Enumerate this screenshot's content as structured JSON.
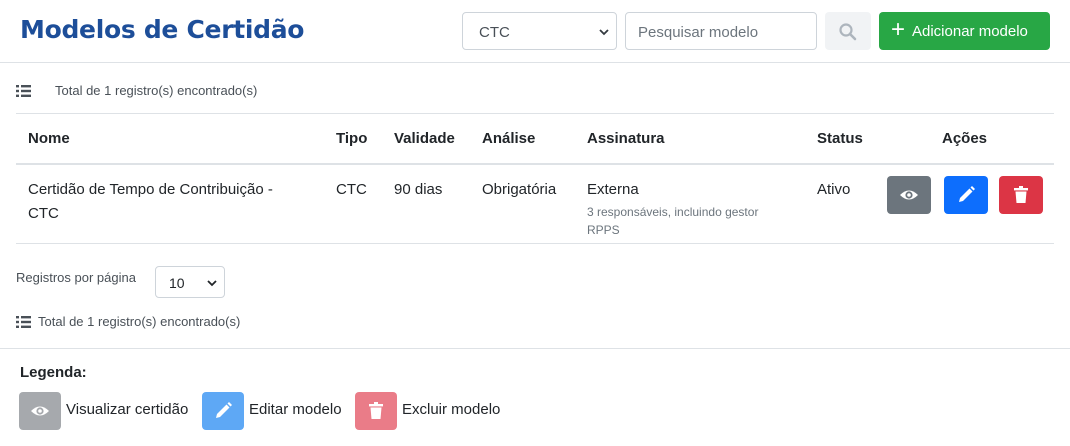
{
  "header": {
    "title": "Modelos de Certidão",
    "type_filter": {
      "selected": "CTC"
    },
    "search": {
      "placeholder": "Pesquisar modelo"
    },
    "add_button": {
      "label": "Adicionar modelo"
    }
  },
  "summary_top": "Total de 1 registro(s) encontrado(s)",
  "table": {
    "columns": [
      "Nome",
      "Tipo",
      "Validade",
      "Análise",
      "Assinatura",
      "Status",
      "Ações"
    ],
    "rows": [
      {
        "nome": "Certidão de Tempo de Contribuição - CTC",
        "tipo": "CTC",
        "validade": "90 dias",
        "analise": "Obrigatória",
        "assinatura": "Externa",
        "assinatura_detail": "3 responsáveis, incluindo gestor RPPS",
        "status": "Ativo"
      }
    ]
  },
  "pagination": {
    "per_page_label": "Registros por página",
    "per_page_value": "10"
  },
  "summary_bottom": "Total de 1 registro(s) encontrado(s)",
  "legend": {
    "title": "Legenda:",
    "items": [
      {
        "label": "Visualizar certidão",
        "icon": "eye-icon",
        "color": "#a6a9ad"
      },
      {
        "label": "Editar modelo",
        "icon": "pencil-icon",
        "color": "#5ea8f5"
      },
      {
        "label": "Excluir modelo",
        "icon": "trash-icon",
        "color": "#ea7c88"
      }
    ]
  },
  "colors": {
    "title": "#1d4e99",
    "primary": "#0d6efd",
    "success": "#28a745",
    "danger": "#dc3545",
    "secondary": "#6c757d"
  }
}
